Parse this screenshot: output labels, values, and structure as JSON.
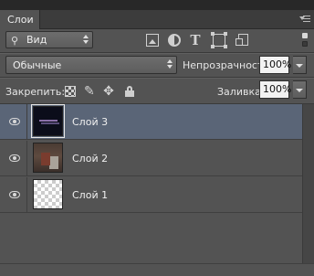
{
  "panel": {
    "tab_label": "Слои"
  },
  "filter": {
    "kind_label": "Вид"
  },
  "blend": {
    "mode_label": "Обычные",
    "opacity_label": "Непрозрачность:",
    "opacity_value": "100%"
  },
  "lock": {
    "label": "Закрепить:",
    "fill_label": "Заливка:",
    "fill_value": "100%"
  },
  "layers": [
    {
      "name": "Слой 3",
      "visible": true,
      "selected": true
    },
    {
      "name": "Слой 2",
      "visible": true,
      "selected": false
    },
    {
      "name": "Слой 1",
      "visible": true,
      "selected": false
    }
  ],
  "colors": {
    "panel_bg": "#535353",
    "selected_row": "#5a6577"
  }
}
